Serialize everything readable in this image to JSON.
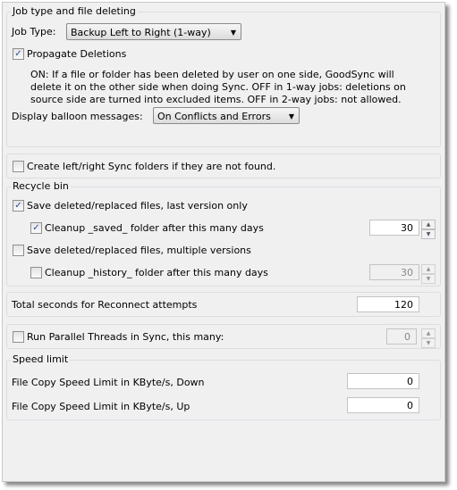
{
  "job_group": {
    "legend": "Job type and file deleting",
    "job_type_label": "Job Type:",
    "job_type_value": "Backup Left to Right (1-way)",
    "propagate_label": "Propagate Deletions",
    "propagate_checked": true,
    "description": [
      "ON: If a file or folder has been deleted by user on one side, GoodSync will",
      "delete it on the other side when doing Sync.  OFF in 1-way jobs: deletions on",
      "source side are turned into excluded items. OFF in 2-way jobs: not allowed."
    ],
    "balloon_label": "Display balloon messages:",
    "balloon_value": "On Conflicts and Errors"
  },
  "create_folders": {
    "label": "Create left/right Sync folders if they are not found.",
    "checked": false
  },
  "recycle": {
    "legend": "Recycle bin",
    "save_last_label": "Save deleted/replaced files, last version only",
    "save_last_checked": true,
    "cleanup_saved_label": "Cleanup _saved_ folder after this many days",
    "cleanup_saved_checked": true,
    "cleanup_saved_days": "30",
    "save_multi_label": "Save deleted/replaced files, multiple versions",
    "save_multi_checked": false,
    "cleanup_history_label": "Cleanup _history_ folder after this many days",
    "cleanup_history_checked": false,
    "cleanup_history_days": "30"
  },
  "reconnect": {
    "label": "Total seconds for Reconnect attempts",
    "value": "120"
  },
  "parallel": {
    "label": "Run Parallel Threads in Sync, this many:",
    "checked": false,
    "value": "0"
  },
  "speed": {
    "legend": "Speed limit",
    "down_label": "File Copy Speed Limit in KByte/s, Down",
    "down_value": "0",
    "up_label": "File Copy Speed Limit in KByte/s, Up",
    "up_value": "0"
  },
  "icons": {
    "check": "✓",
    "dropdown": "▼",
    "up": "▲",
    "down": "▼"
  }
}
